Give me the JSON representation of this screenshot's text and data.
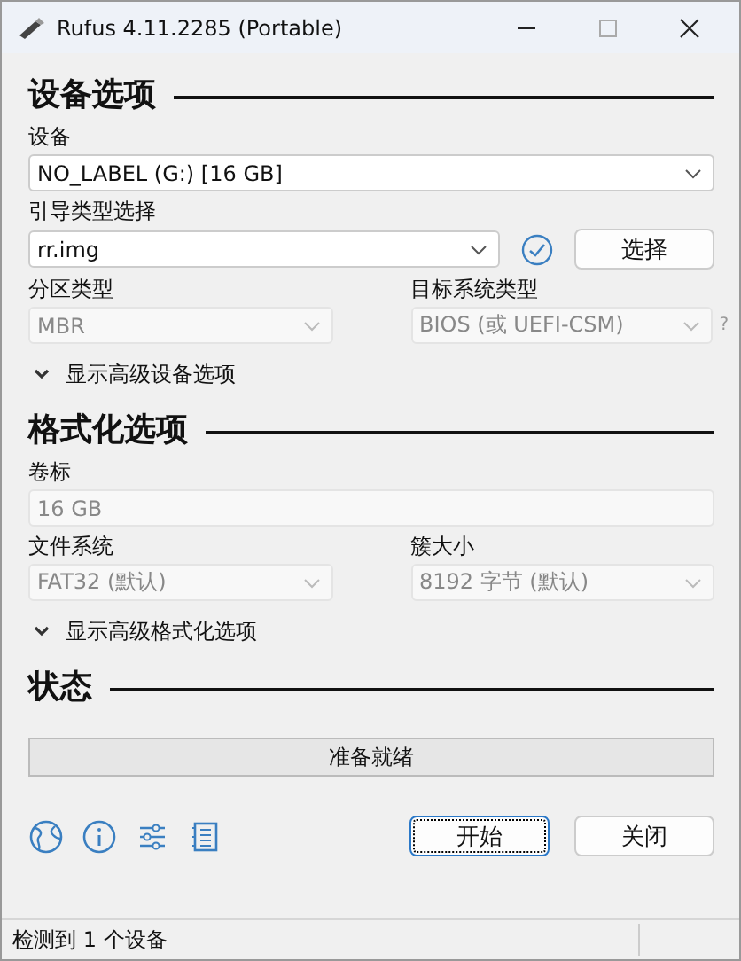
{
  "window": {
    "title": "Rufus 4.11.2285 (Portable)"
  },
  "sections": [
    {
      "heading": "设备选项",
      "rows": [
        {
          "kind": "full",
          "fields": [
            {
              "label": "设备",
              "kind": "select",
              "value": "NO_LABEL (G:) [16 GB]",
              "disabled": false
            }
          ]
        },
        {
          "kind": "boot",
          "fields": [
            {
              "label": "引导类型选择",
              "kind": "select",
              "value": "rr.img",
              "disabled": false
            }
          ],
          "button": "选择"
        },
        {
          "kind": "half",
          "fields": [
            {
              "label": "分区类型",
              "kind": "select",
              "value": "MBR",
              "disabled": true
            },
            {
              "label": "目标系统类型",
              "kind": "select",
              "value": "BIOS (或 UEFI-CSM)",
              "disabled": true,
              "help": "?"
            }
          ]
        }
      ],
      "toggle": "显示高级设备选项"
    },
    {
      "heading": "格式化选项",
      "rows": [
        {
          "kind": "full",
          "fields": [
            {
              "label": "卷标",
              "kind": "text",
              "value": "16 GB",
              "disabled": true
            }
          ]
        },
        {
          "kind": "half",
          "fields": [
            {
              "label": "文件系统",
              "kind": "select",
              "value": "FAT32 (默认)",
              "disabled": true
            },
            {
              "label": "簇大小",
              "kind": "select",
              "value": "8192 字节 (默认)",
              "disabled": true
            }
          ]
        }
      ],
      "toggle": "显示高级格式化选项"
    },
    {
      "heading": "状态",
      "progress": {
        "text": "准备就绪",
        "level": 0
      }
    }
  ],
  "buttons": [
    {
      "label": "开始",
      "focused": true
    },
    {
      "label": "关闭",
      "focused": false
    }
  ],
  "status_bar": "检测到 1 个设备"
}
